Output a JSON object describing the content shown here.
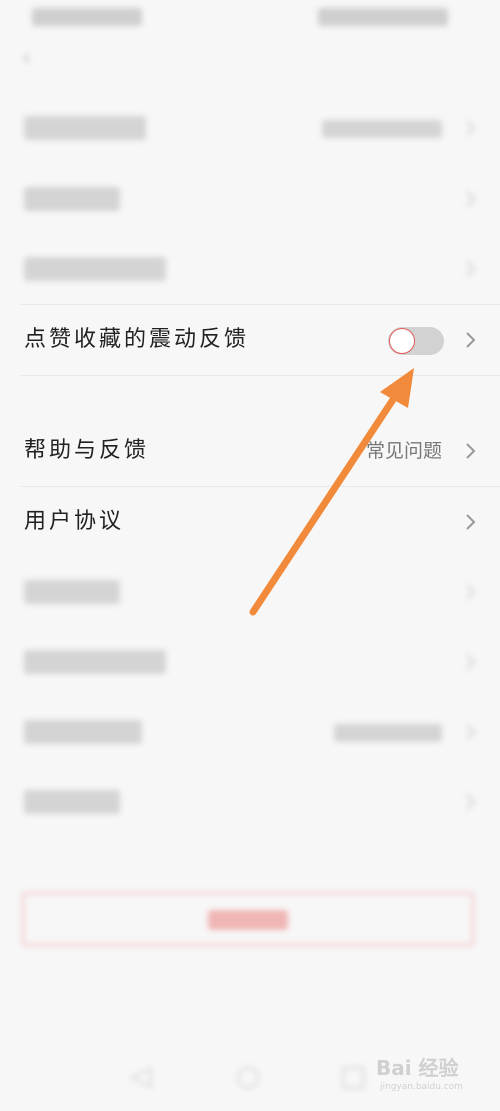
{
  "status_bar": {
    "left": "",
    "right": ""
  },
  "settings": {
    "rows": [
      {
        "label": "账号管理",
        "value": "",
        "blurred": true
      },
      {
        "label": "浏览历史",
        "value": "",
        "blurred": true
      },
      {
        "label": "消息通知设置",
        "value": "",
        "blurred": true
      },
      {
        "label": "点赞收藏的震动反馈",
        "toggle": false
      },
      {
        "label": "帮助与反馈",
        "value": "常见问题"
      },
      {
        "label": "用户协议",
        "value": ""
      },
      {
        "label": "隐私设置",
        "value": "",
        "blurred": true
      },
      {
        "label": "关于我们",
        "value": "",
        "blurred": true
      },
      {
        "label": "版本",
        "value": "",
        "blurred": true
      },
      {
        "label": "清理缓存",
        "value": "",
        "blurred": true
      }
    ]
  },
  "logout": {
    "label": ""
  },
  "annotation": {
    "arrow_color": "#f28a3c"
  },
  "watermark": {
    "main": "Bai 经验",
    "sub": "jingyan.baidu.com"
  },
  "colors": {
    "toggle_off": "#d2d2d2",
    "toggle_knob_border": "#e45a5a",
    "text": "#222222",
    "muted": "#777777"
  }
}
